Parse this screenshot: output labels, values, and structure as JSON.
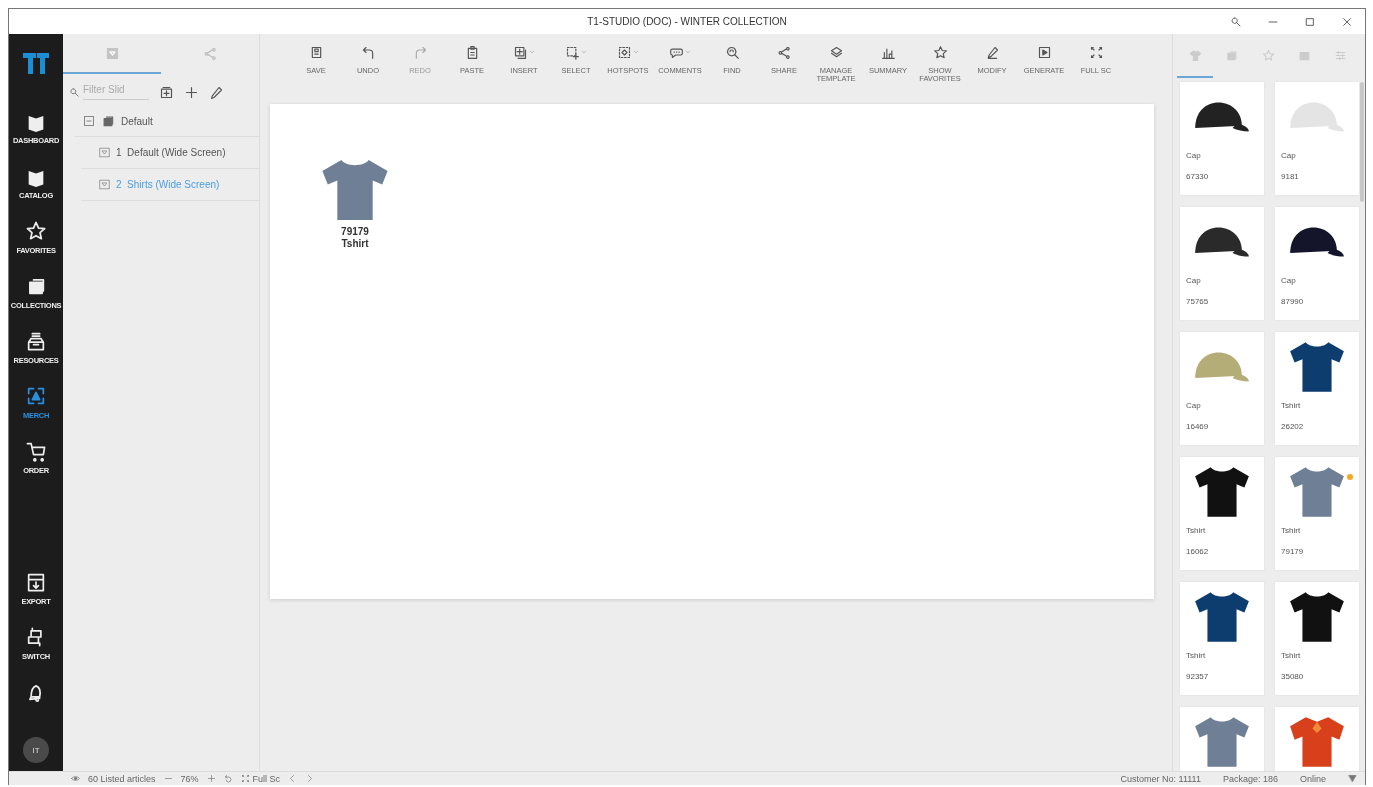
{
  "window": {
    "title": "T1-STUDIO (DOC) - WINTER COLLECTION"
  },
  "nav": {
    "items": [
      {
        "label": "DASHBOARD",
        "selected": false
      },
      {
        "label": "CATALOG",
        "selected": false
      },
      {
        "label": "FAVORITES",
        "selected": false
      },
      {
        "label": "COLLECTIONS",
        "selected": false
      },
      {
        "label": "RESOURCES",
        "selected": false
      },
      {
        "label": "MERCH",
        "selected": true
      },
      {
        "label": "ORDER",
        "selected": false
      }
    ],
    "bottom_items": [
      {
        "label": "EXPORT"
      },
      {
        "label": "SWITCH"
      }
    ],
    "avatar": "IT"
  },
  "slides_panel": {
    "tabs": [
      {
        "selected": true
      },
      {
        "selected": false
      }
    ],
    "filter": {
      "placeholder": "Filter Slid"
    },
    "tree": [
      {
        "label": "Default",
        "expanded": true,
        "children": [
          {
            "index": "1",
            "label": "Default (Wide Screen)",
            "selected": false
          },
          {
            "index": "2",
            "label": "Shirts (Wide Screen)",
            "selected": true
          }
        ]
      }
    ]
  },
  "toolbar": [
    {
      "label": "SAVE",
      "disabled": false,
      "dropdown": false
    },
    {
      "label": "UNDO",
      "disabled": false,
      "dropdown": false
    },
    {
      "label": "REDO",
      "disabled": true,
      "dropdown": false
    },
    {
      "label": "PASTE",
      "disabled": false,
      "dropdown": false
    },
    {
      "label": "INSERT",
      "disabled": false,
      "dropdown": true
    },
    {
      "label": "SELECT",
      "disabled": false,
      "dropdown": true
    },
    {
      "label": "HOTSPOTS",
      "disabled": false,
      "dropdown": true
    },
    {
      "label": "COMMENTS",
      "disabled": false,
      "dropdown": true
    },
    {
      "label": "FIND",
      "disabled": false,
      "dropdown": false
    },
    {
      "label": "SHARE",
      "disabled": false,
      "dropdown": false
    },
    {
      "label": "MANAGE TEMPLATE",
      "disabled": false,
      "dropdown": false
    },
    {
      "label": "SUMMARY",
      "disabled": false,
      "dropdown": false
    },
    {
      "label": "SHOW FAVORITES",
      "disabled": false,
      "dropdown": false
    },
    {
      "label": "MODIFY",
      "disabled": false,
      "dropdown": false
    },
    {
      "label": "GENERATE",
      "disabled": false,
      "dropdown": false
    },
    {
      "label": "FULL SC",
      "disabled": false,
      "dropdown": false
    }
  ],
  "slide": {
    "items": [
      {
        "number": "79179",
        "name": "Tshirt",
        "kind": "tshirt",
        "color": "#6f7f96"
      }
    ]
  },
  "article_panel": {
    "tabs": [
      {
        "selected": true
      },
      {
        "selected": false
      },
      {
        "selected": false
      },
      {
        "selected": false
      },
      {
        "selected": false
      }
    ],
    "articles": [
      {
        "name": "Cap",
        "number": "67330",
        "kind": "cap",
        "color": "#222222",
        "flagged": false
      },
      {
        "name": "Cap",
        "number": "9181",
        "kind": "cap",
        "color": "#e4e4e4",
        "flagged": false
      },
      {
        "name": "Cap",
        "number": "75765",
        "kind": "cap",
        "color": "#2a2a2a",
        "flagged": false
      },
      {
        "name": "Cap",
        "number": "87990",
        "kind": "cap",
        "color": "#14142a",
        "flagged": false
      },
      {
        "name": "Cap",
        "number": "16469",
        "kind": "cap",
        "color": "#b5ad78",
        "flagged": false
      },
      {
        "name": "Tshirt",
        "number": "26202",
        "kind": "tshirt",
        "color": "#0d3c6e",
        "flagged": false
      },
      {
        "name": "Tshirt",
        "number": "16062",
        "kind": "tshirt",
        "color": "#111111",
        "flagged": false
      },
      {
        "name": "Tshirt",
        "number": "79179",
        "kind": "tshirt",
        "color": "#6f7f96",
        "flagged": true
      },
      {
        "name": "Tshirt",
        "number": "92357",
        "kind": "tshirt",
        "color": "#0d3c6e",
        "flagged": false
      },
      {
        "name": "Tshirt",
        "number": "35080",
        "kind": "tshirt",
        "color": "#111111",
        "flagged": false
      },
      {
        "kind": "tshirt",
        "color": "#6f7f96",
        "flagged": false
      },
      {
        "kind": "polo",
        "color": "#d8401c",
        "flagged": false
      }
    ]
  },
  "status_bar": {
    "articles": "60 Listed articles",
    "zoom": "76%",
    "full_screen": "Full Sc",
    "customer": "Customer No: 11111",
    "package": "Package: 186",
    "connection": "Online"
  }
}
